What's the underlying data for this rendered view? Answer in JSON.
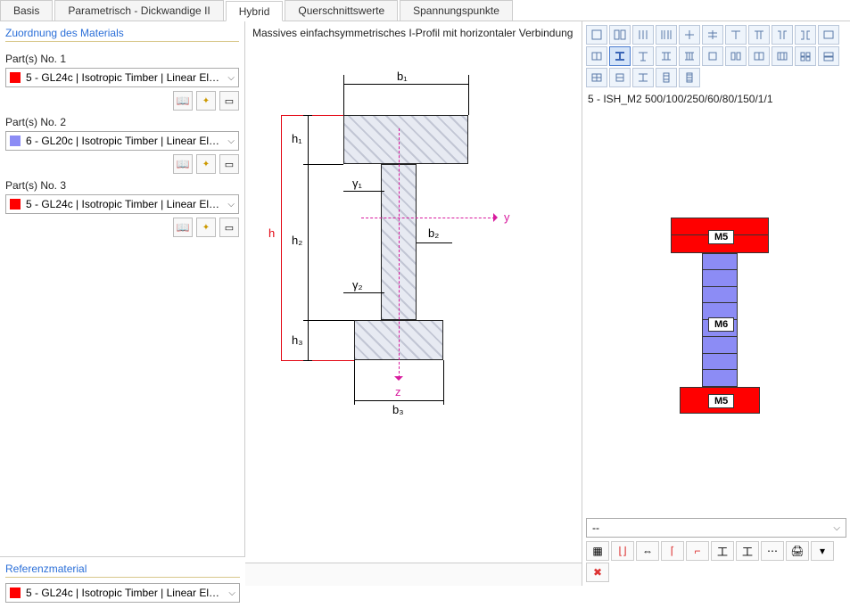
{
  "tabs": [
    "Basis",
    "Parametrisch - Dickwandige II",
    "Hybrid",
    "Querschnittswerte",
    "Spannungspunkte"
  ],
  "active_tab": "Hybrid",
  "left": {
    "title": "Zuordnung des Materials",
    "parts": [
      {
        "label": "Part(s) No. 1",
        "material": "5 - GL24c | Isotropic Timber | Linear Elast...",
        "color": "#ff0000"
      },
      {
        "label": "Part(s) No. 2",
        "material": "6 - GL20c | Isotropic Timber | Linear Elast...",
        "color": "#8c8cf5"
      },
      {
        "label": "Part(s) No. 3",
        "material": "5 - GL24c | Isotropic Timber | Linear Elast...",
        "color": "#ff0000"
      }
    ],
    "ref_title": "Referenzmaterial",
    "ref_material": "5 - GL24c | Isotropic Timber | Linear Elast...",
    "ref_color": "#ff0000"
  },
  "center": {
    "title": "Massives einfachsymmetrisches I-Profil mit horizontaler Verbindung",
    "dims": {
      "b1": "b₁",
      "b2": "b₂",
      "b3": "b₃",
      "h": "h",
      "h1": "h₁",
      "h2": "h₂",
      "h3": "h₃",
      "g1": "γ₁",
      "g2": "γ₂",
      "y": "y",
      "z": "z"
    }
  },
  "right": {
    "section_name": "5 - ISH_M2 500/100/250/60/80/150/1/1",
    "labels": {
      "top": "M5",
      "mid": "M6",
      "bot": "M5"
    },
    "dropdown_value": "--",
    "colors": {
      "flange": "#ff0000",
      "web": "#8c8cf5"
    }
  },
  "chart_data": {
    "type": "diagram",
    "profile": "I-section solid single-symmetric with horizontal connection",
    "parameters": [
      "b1",
      "b2",
      "b3",
      "h",
      "h1",
      "h2",
      "h3",
      "γ1",
      "γ2"
    ],
    "axes": [
      "y",
      "z"
    ],
    "preview_section": {
      "name": "ISH_M2 500/100/250/60/80/150/1/1",
      "parts": [
        {
          "id": "top-flange",
          "material": "M5",
          "color": "#ff0000"
        },
        {
          "id": "web",
          "material": "M6",
          "color": "#8c8cf5"
        },
        {
          "id": "bottom-flange",
          "material": "M5",
          "color": "#ff0000"
        }
      ]
    }
  }
}
